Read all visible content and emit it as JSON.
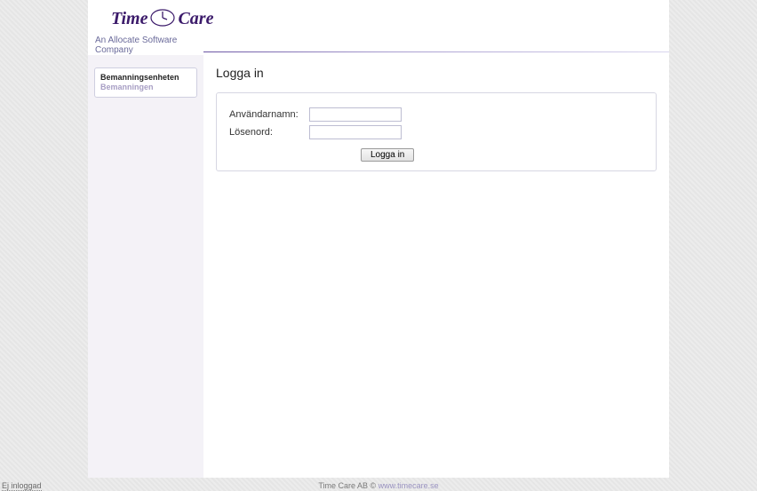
{
  "header": {
    "logo_left": "Time",
    "logo_right": "Care",
    "tagline": "An Allocate Software Company"
  },
  "sidebar": {
    "box": {
      "line1": "Bemanningsenheten",
      "line2": "Bemanningen"
    }
  },
  "login": {
    "title": "Logga in",
    "username_label": "Användarnamn:",
    "password_label": "Lösenord:",
    "button_label": "Logga in"
  },
  "footer": {
    "status": "Ej inloggad",
    "company": "Time Care AB ©",
    "link_text": "www.timecare.se"
  }
}
